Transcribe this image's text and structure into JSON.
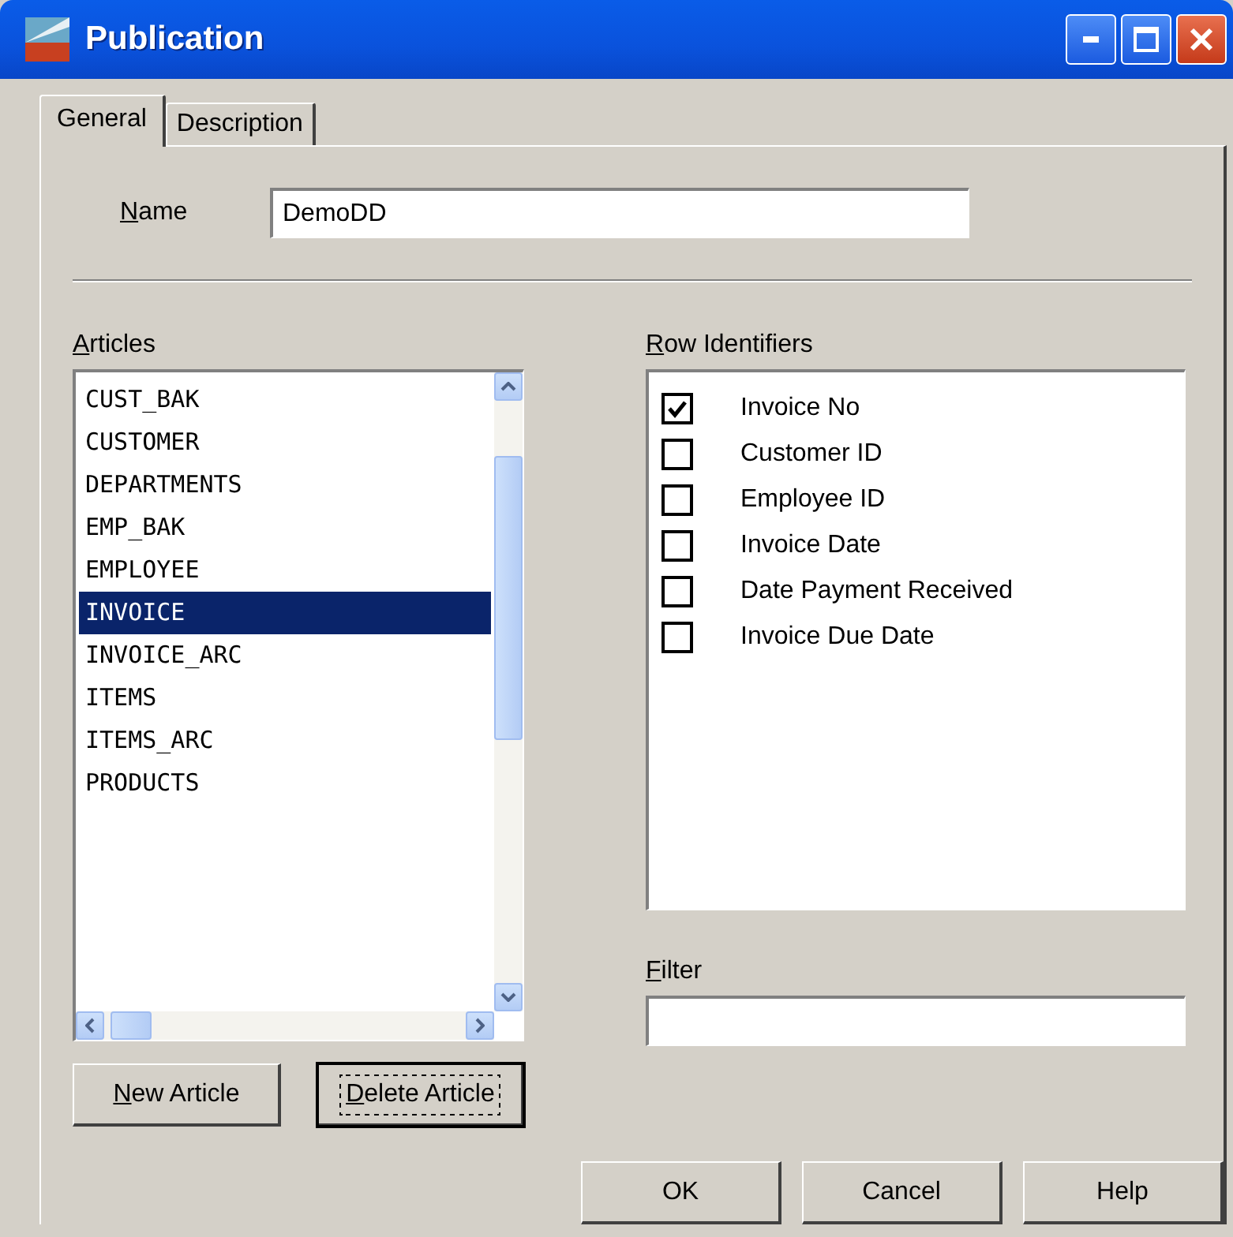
{
  "window": {
    "title": "Publication"
  },
  "tabs": [
    {
      "label": "General",
      "selected": true
    },
    {
      "label": "Description",
      "selected": false
    }
  ],
  "name_field": {
    "label": "Name",
    "mnemonic": true,
    "value": "DemoDD"
  },
  "articles": {
    "label": "Articles",
    "mnemonic": true,
    "items": [
      {
        "label": "CUST_BAK",
        "selected": false
      },
      {
        "label": "CUSTOMER",
        "selected": false
      },
      {
        "label": "DEPARTMENTS",
        "selected": false
      },
      {
        "label": "EMP_BAK",
        "selected": false
      },
      {
        "label": "EMPLOYEE",
        "selected": false
      },
      {
        "label": "INVOICE",
        "selected": true
      },
      {
        "label": "INVOICE_ARC",
        "selected": false
      },
      {
        "label": "ITEMS",
        "selected": false
      },
      {
        "label": "ITEMS_ARC",
        "selected": false
      },
      {
        "label": "PRODUCTS",
        "selected": false
      }
    ]
  },
  "row_identifiers": {
    "label": "Row Identifiers",
    "mnemonic": true,
    "items": [
      {
        "label": "Invoice No",
        "checked": true
      },
      {
        "label": "Customer ID",
        "checked": false
      },
      {
        "label": "Employee ID",
        "checked": false
      },
      {
        "label": "Invoice Date",
        "checked": false
      },
      {
        "label": "Date Payment Received",
        "checked": false
      },
      {
        "label": "Invoice Due Date",
        "checked": false
      }
    ]
  },
  "filter": {
    "label": "Filter",
    "mnemonic": true
  },
  "article_buttons": [
    {
      "label": "New Article",
      "mnemonic": true,
      "default": false
    },
    {
      "label": "Delete Article",
      "mnemonic": true,
      "default": true
    }
  ],
  "dialog_buttons": [
    {
      "label": "OK"
    },
    {
      "label": "Cancel"
    },
    {
      "label": "Help"
    }
  ]
}
